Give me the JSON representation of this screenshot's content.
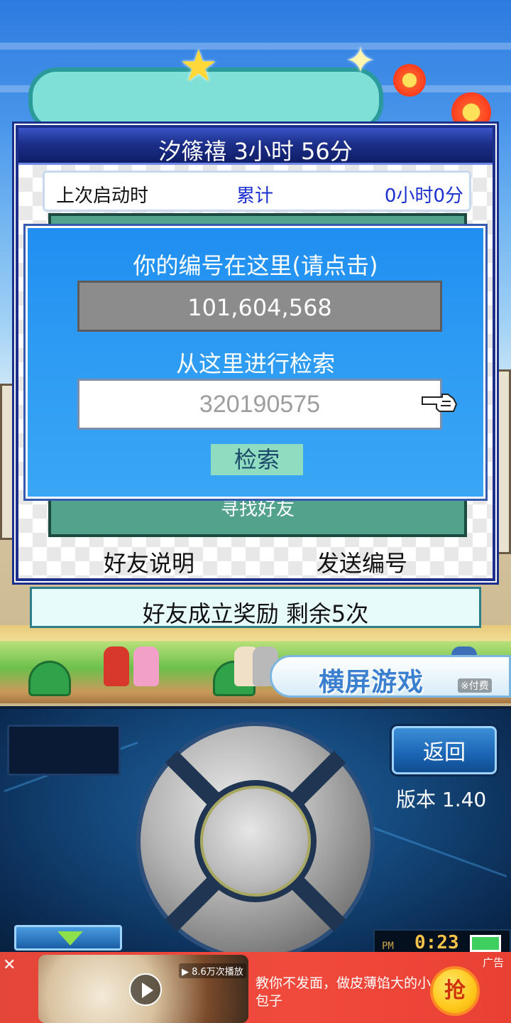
{
  "dialog": {
    "title": "汐篠禧  3小时 56分",
    "last_launch_label": "上次启动时",
    "total_label": "累计",
    "total_value": "0小时0分",
    "find_friend_label": "寻找好友",
    "friend_help_label": "好友说明",
    "send_id_label": "发送编号"
  },
  "id_panel": {
    "id_label": "你的编号在这里(请点击)",
    "id_value": "101,604,568",
    "search_label": "从这里进行检索",
    "search_placeholder": "320190575",
    "search_button": "检索"
  },
  "reward": {
    "text": "好友成立奖励  剩余5次"
  },
  "scene": {
    "landscape_button": "横屏游戏",
    "landscape_tag": "※付费"
  },
  "controls": {
    "back_button": "返回",
    "version": "版本 1.40",
    "clock_period": "PM",
    "clock_time": "0:23"
  },
  "ad": {
    "views": "▶ 8.6万次播放",
    "text": "教你不发面，做皮薄馅大的小包子",
    "tag": "广告",
    "grab_button": "抢"
  },
  "colors": {
    "dialog_header": "#1c2f8a",
    "overlay_bg": "#2c9af3",
    "panel_green": "#52a28c",
    "accent_blue_text": "#1a2fcf",
    "ad_red": "#f04a3c"
  }
}
